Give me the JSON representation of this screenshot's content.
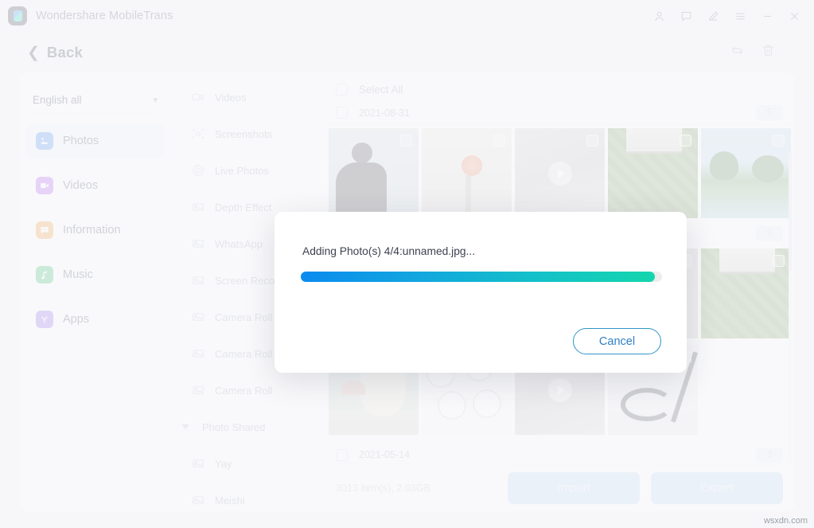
{
  "window": {
    "app_title": "Wondershare MobileTrans",
    "logo_icon": "mobiletrans-logo-icon",
    "controls": [
      {
        "name": "account-icon",
        "glyph": "person"
      },
      {
        "name": "feedback-icon",
        "glyph": "chat"
      },
      {
        "name": "edit-icon",
        "glyph": "pen"
      },
      {
        "name": "menu-icon",
        "glyph": "hamburger"
      },
      {
        "name": "minimize-button",
        "glyph": "minus"
      },
      {
        "name": "close-button",
        "glyph": "cross"
      }
    ]
  },
  "header": {
    "back_label": "Back",
    "back_icon": "chevron-left-icon",
    "tools": [
      {
        "name": "refresh-icon",
        "label": "refresh"
      },
      {
        "name": "delete-icon",
        "label": "delete"
      }
    ]
  },
  "sidebar": {
    "language": {
      "value": "English all",
      "chevron": "chevron-down-icon"
    },
    "items": [
      {
        "label": "Photos",
        "icon": "photos-icon",
        "color": "#2f7ff0",
        "active": true
      },
      {
        "label": "Videos",
        "icon": "videos-icon",
        "color": "#a63df0",
        "active": false
      },
      {
        "label": "Information",
        "icon": "information-icon",
        "color": "#f0921f",
        "active": false
      },
      {
        "label": "Music",
        "icon": "music-icon",
        "color": "#22b455",
        "active": false
      },
      {
        "label": "Apps",
        "icon": "apps-icon",
        "color": "#8257ea",
        "active": false
      }
    ]
  },
  "folders": {
    "items": [
      {
        "label": "Videos",
        "icon": "video-folder-icon",
        "type": "item"
      },
      {
        "label": "Screenshots",
        "icon": "screenshot-folder-icon",
        "type": "item"
      },
      {
        "label": "Live Photos",
        "icon": "live-photo-folder-icon",
        "type": "item"
      },
      {
        "label": "Depth Effect",
        "icon": "photo-folder-icon",
        "type": "item"
      },
      {
        "label": "WhatsApp",
        "icon": "photo-folder-icon",
        "type": "item"
      },
      {
        "label": "Screen Recorder",
        "icon": "photo-folder-icon",
        "type": "item"
      },
      {
        "label": "Camera Roll",
        "icon": "photo-folder-icon",
        "type": "item"
      },
      {
        "label": "Camera Roll",
        "icon": "photo-folder-icon",
        "type": "item"
      },
      {
        "label": "Camera Roll",
        "icon": "photo-folder-icon",
        "type": "item"
      },
      {
        "label": "Photo Shared",
        "icon": "caret-down-icon",
        "type": "group"
      },
      {
        "label": "Yay",
        "icon": "photo-folder-icon",
        "type": "item"
      },
      {
        "label": "Meishi",
        "icon": "photo-folder-icon",
        "type": "item"
      }
    ]
  },
  "main": {
    "select_all_label": "Select All",
    "groups": [
      {
        "date": "2021-08-31",
        "count": "5"
      },
      {
        "date": "2021-05-14",
        "count": "3"
      }
    ],
    "mid_badge": "9",
    "thumb_rows": [
      [
        {
          "name": "thumb-person",
          "art": "art-person",
          "video": false
        },
        {
          "name": "thumb-flowers",
          "art": "art-flowers",
          "video": false
        },
        {
          "name": "thumb-video-clip",
          "art": "art-video",
          "video": true
        },
        {
          "name": "thumb-garden-leaves",
          "art": "art-leaves",
          "video": false
        },
        {
          "name": "thumb-beach-palms",
          "art": "art-beach",
          "video": false
        }
      ],
      [
        {
          "name": "thumb-house-window",
          "art": "art-leaves",
          "video": false
        },
        {
          "name": "thumb-plants",
          "art": "art-beach",
          "video": false
        },
        {
          "name": "thumb-room",
          "art": "art-room",
          "video": false
        },
        {
          "name": "thumb-window-frame",
          "art": "art-room",
          "video": false
        },
        {
          "name": "thumb-garden",
          "art": "art-leaves",
          "video": false
        }
      ],
      [
        {
          "name": "thumb-illustration",
          "art": "art-ghibli",
          "video": false
        },
        {
          "name": "thumb-infographic",
          "art": "art-chart",
          "video": false
        },
        {
          "name": "thumb-video-room",
          "art": "art-video",
          "video": true
        },
        {
          "name": "thumb-cable",
          "art": "art-cable",
          "video": false
        }
      ]
    ]
  },
  "bottom": {
    "item_count": "3013 item(s), 2.03GB",
    "import_label": "Import",
    "export_label": "Export"
  },
  "dialog": {
    "message": "Adding Photo(s) 4/4:unnamed.jpg...",
    "progress_percent": 98,
    "cancel_label": "Cancel",
    "accent_start": "#0b8bef",
    "accent_end": "#14d6ad"
  },
  "watermark": "wsxdn.com"
}
